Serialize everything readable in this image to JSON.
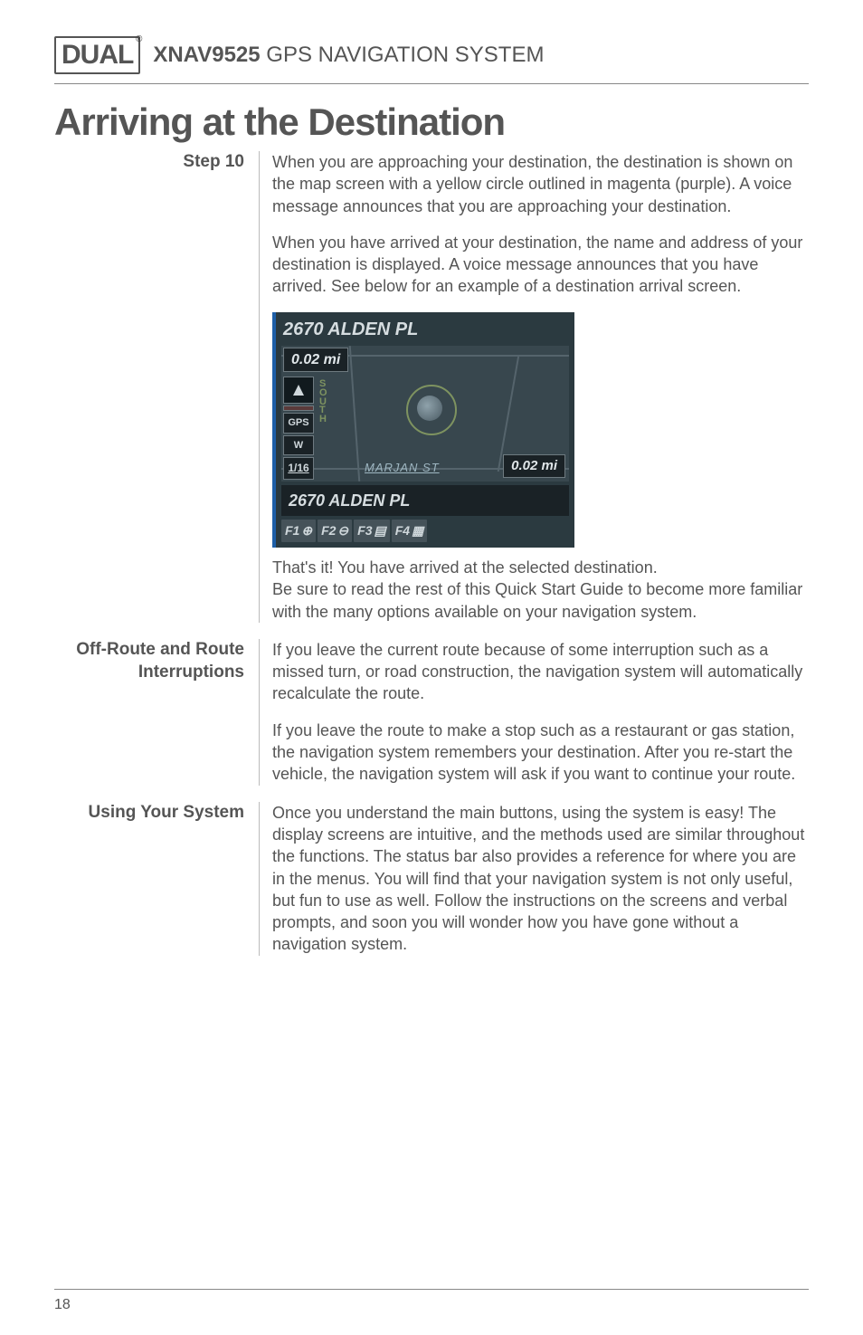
{
  "header": {
    "logo_text": "DUAL",
    "logo_reg": "®",
    "model": "XNAV9525",
    "product": " GPS NAVIGATION SYSTEM"
  },
  "title": "Arriving at the Destination",
  "sections": [
    {
      "label": "Step 10",
      "paragraphs": [
        "When you are approaching your destination, the destination is shown on the map screen with a yellow circle outlined in magenta (purple).  A voice message announces that you are approaching your destination.",
        "When you have arrived at your destination, the name and address of your destination is displayed. A voice message announces that you have arrived. See below for an example of a destination arrival screen."
      ],
      "screenshot": {
        "title": "2670 ALDEN PL",
        "dist_top": "0.02 mi",
        "pills": {
          "gps": "GPS",
          "w": "W",
          "count": "1/16"
        },
        "vletters": "S\nO\nU\nT\nH",
        "road": "MARJAN ST",
        "dist_right": "0.02 mi",
        "addr_bar": "2670 ALDEN PL",
        "f1": "F1",
        "f2": "F2",
        "f3": "F3",
        "f4": "F4"
      },
      "paragraphs_after": [
        "That's it! You have arrived at the selected destination.\nBe sure to read the rest of this Quick Start Guide to become more familiar with the many options available on your navigation system."
      ]
    },
    {
      "label": "Off-Route and Route\nInterruptions",
      "paragraphs": [
        "If you leave the current route because of some interruption such as a missed turn, or road construction, the navigation system will automatically recalculate the route.",
        "If you leave the route to make a stop such as a restaurant or gas station, the navigation system remembers your destination. After you re-start the vehicle, the navigation system will ask if you want to continue your route."
      ]
    },
    {
      "label": "Using Your System",
      "paragraphs": [
        "Once you understand the main buttons, using the system is easy! The display screens are intuitive, and the methods used are similar throughout the functions. The status bar also provides a reference for where you are in the menus. You will find that your navigation system is not only useful, but fun to use as well. Follow the instructions on the screens and verbal prompts, and soon you will wonder how you have gone without a navigation system."
      ]
    }
  ],
  "page_number": "18"
}
